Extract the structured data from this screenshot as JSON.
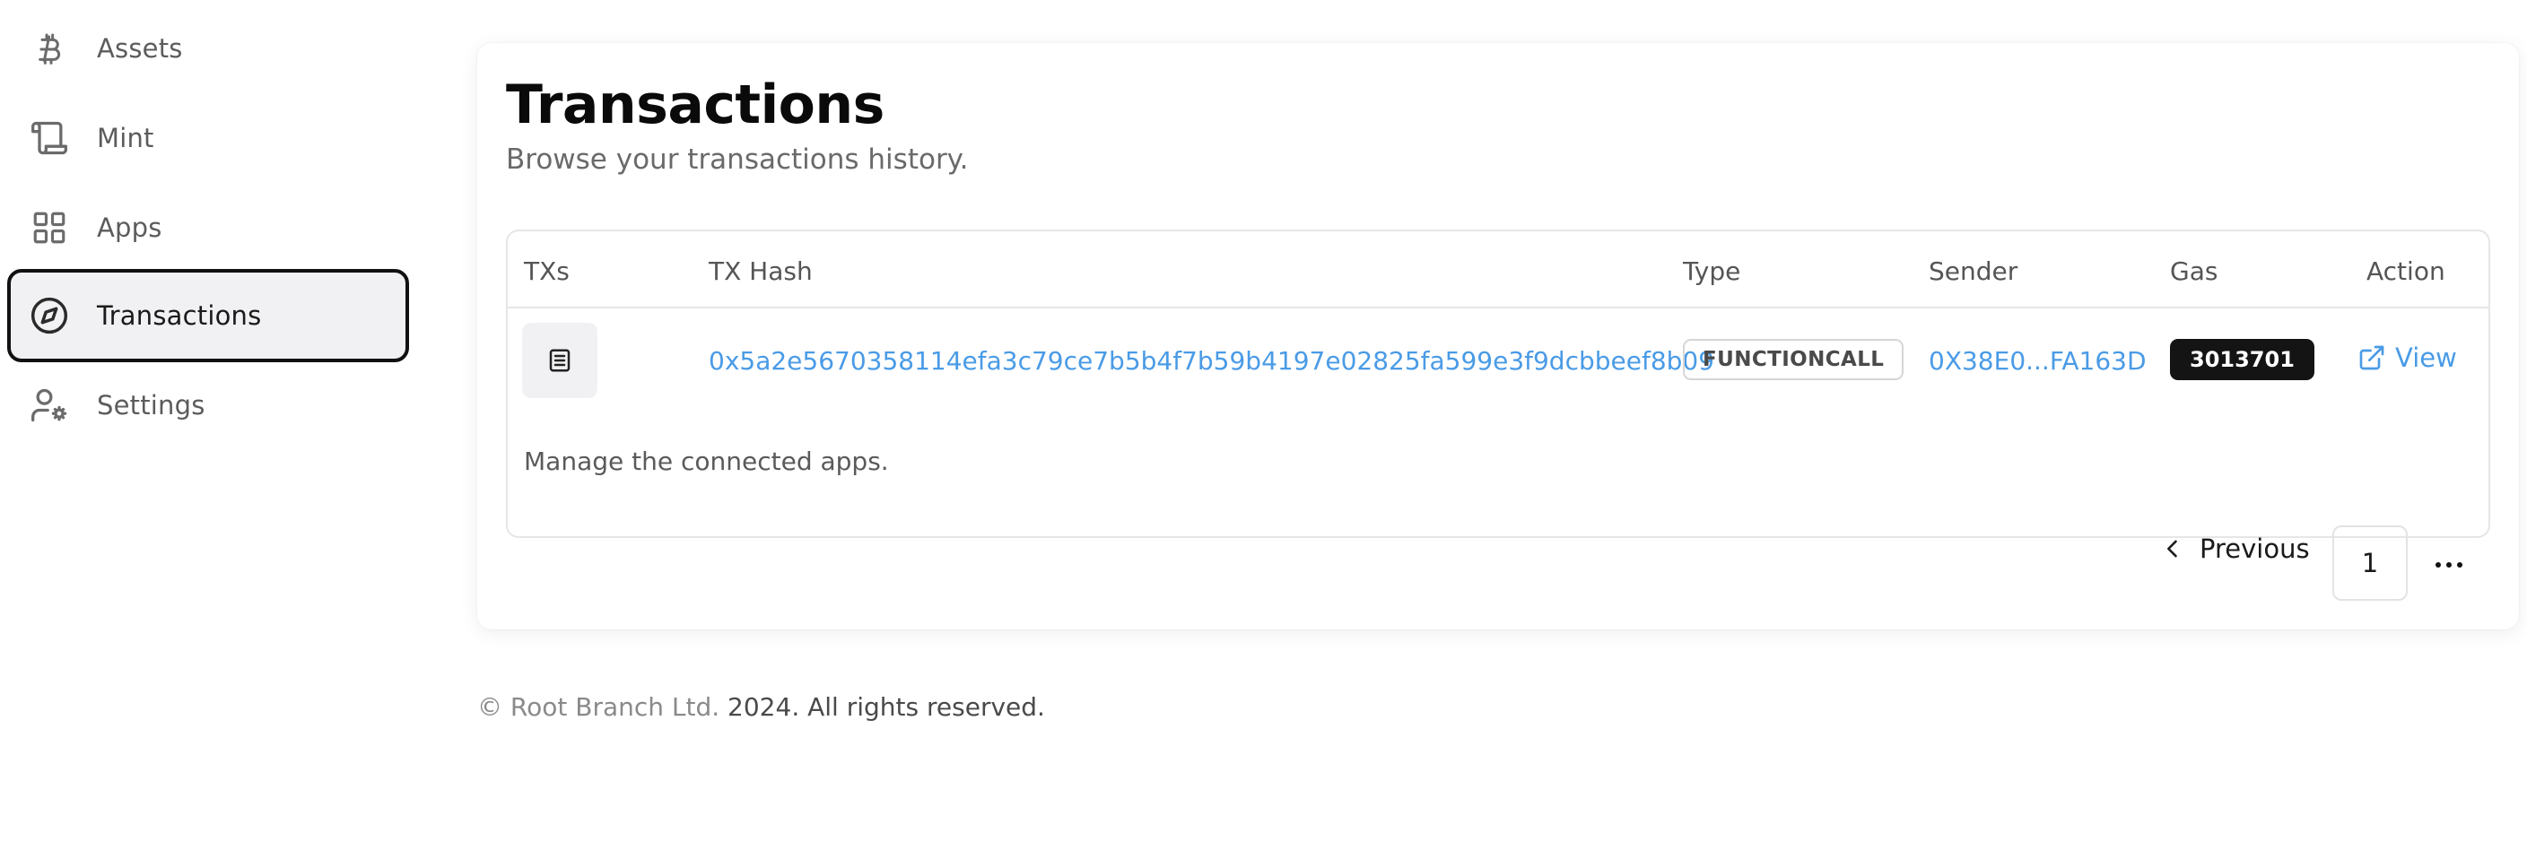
{
  "sidebar": {
    "items": [
      {
        "label": "Assets",
        "icon": "bitcoin-icon",
        "active": false
      },
      {
        "label": "Mint",
        "icon": "scroll-icon",
        "active": false
      },
      {
        "label": "Apps",
        "icon": "grid-icon",
        "active": false
      },
      {
        "label": "Transactions",
        "icon": "compass-icon",
        "active": true
      },
      {
        "label": "Settings",
        "icon": "user-cog-icon",
        "active": false
      }
    ]
  },
  "main": {
    "title": "Transactions",
    "subtitle": "Browse your transactions history.",
    "table": {
      "headers": [
        "TXs",
        "TX Hash",
        "Type",
        "Sender",
        "Gas",
        "Action"
      ],
      "rows": [
        {
          "icon": "receipt-icon",
          "tx_hash": "0x5a2e5670358114efa3c79ce7b5b4f7b59b4197e02825fa599e3f9dcbbeef8b09",
          "type": "FUNCTIONCALL",
          "sender": "0X38E0...FA163D",
          "gas": "3013701",
          "action": "View"
        }
      ],
      "caption": "Manage the connected apps."
    },
    "pagination": {
      "previous_label": "Previous",
      "current_page": "1"
    }
  },
  "footer": {
    "company": "© Root Branch Ltd.",
    "rights": " 2024. All rights reserved."
  },
  "colors": {
    "link": "#4a9be6",
    "active_border": "#111111",
    "active_bg": "#f1f1f3",
    "gas_badge_bg": "#141414"
  }
}
